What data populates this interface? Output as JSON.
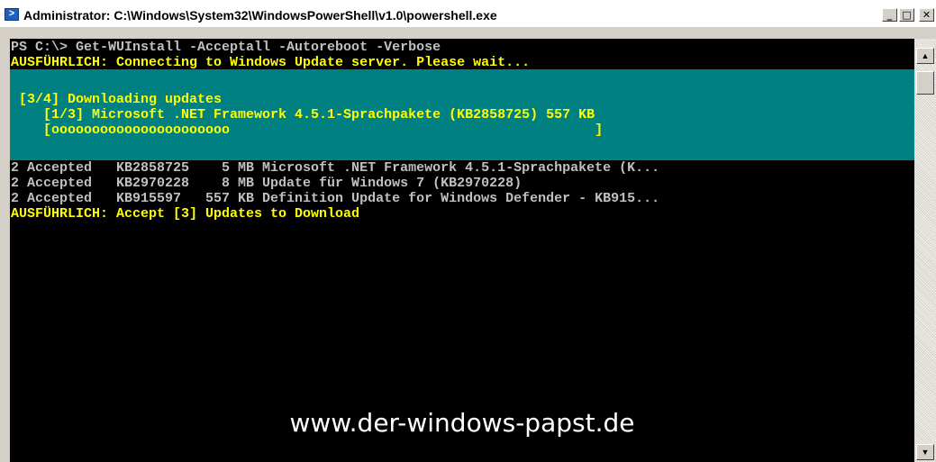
{
  "window": {
    "title": "Administrator: C:\\Windows\\System32\\WindowsPowerShell\\v1.0\\powershell.exe",
    "controls": {
      "minimize": "_",
      "maximize": "□",
      "close": "✕"
    }
  },
  "console": {
    "lines_top": [
      "PS C:\\> Get-WUInstall -Acceptall -Autoreboot -Verbose",
      "AUSFÜHRLICH: Connecting to Windows Update server. Please wait..."
    ],
    "progress": {
      "activity": " [3/4] Downloading updates",
      "status": "    [1/3] Microsoft .NET Framework 4.5.1-Sprachpakete (KB2858725) 557 KB",
      "bar": "    [oooooooooooooooooooooo                                             ]",
      "bar_fill_fraction": 0.32
    },
    "lines_bottom": [
      "2 Accepted   KB2858725    5 MB Microsoft .NET Framework 4.5.1-Sprachpakete (K...",
      "2 Accepted   KB2970228    8 MB Update für Windows 7 (KB2970228)",
      "2 Accepted   KB915597   557 KB Definition Update for Windows Defender - KB915...",
      "AUSFÜHRLICH: Accept [3] Updates to Download"
    ]
  },
  "watermark": "www.der-windows-papst.de",
  "colors": {
    "console_bg": "#000000",
    "progress_bg": "#008080",
    "verbose_text": "#ffff00",
    "normal_text": "#c0c0c0"
  },
  "icons": [
    "powershell-icon",
    "minimize-icon",
    "maximize-icon",
    "close-icon",
    "scroll-up-icon",
    "scroll-down-icon"
  ]
}
